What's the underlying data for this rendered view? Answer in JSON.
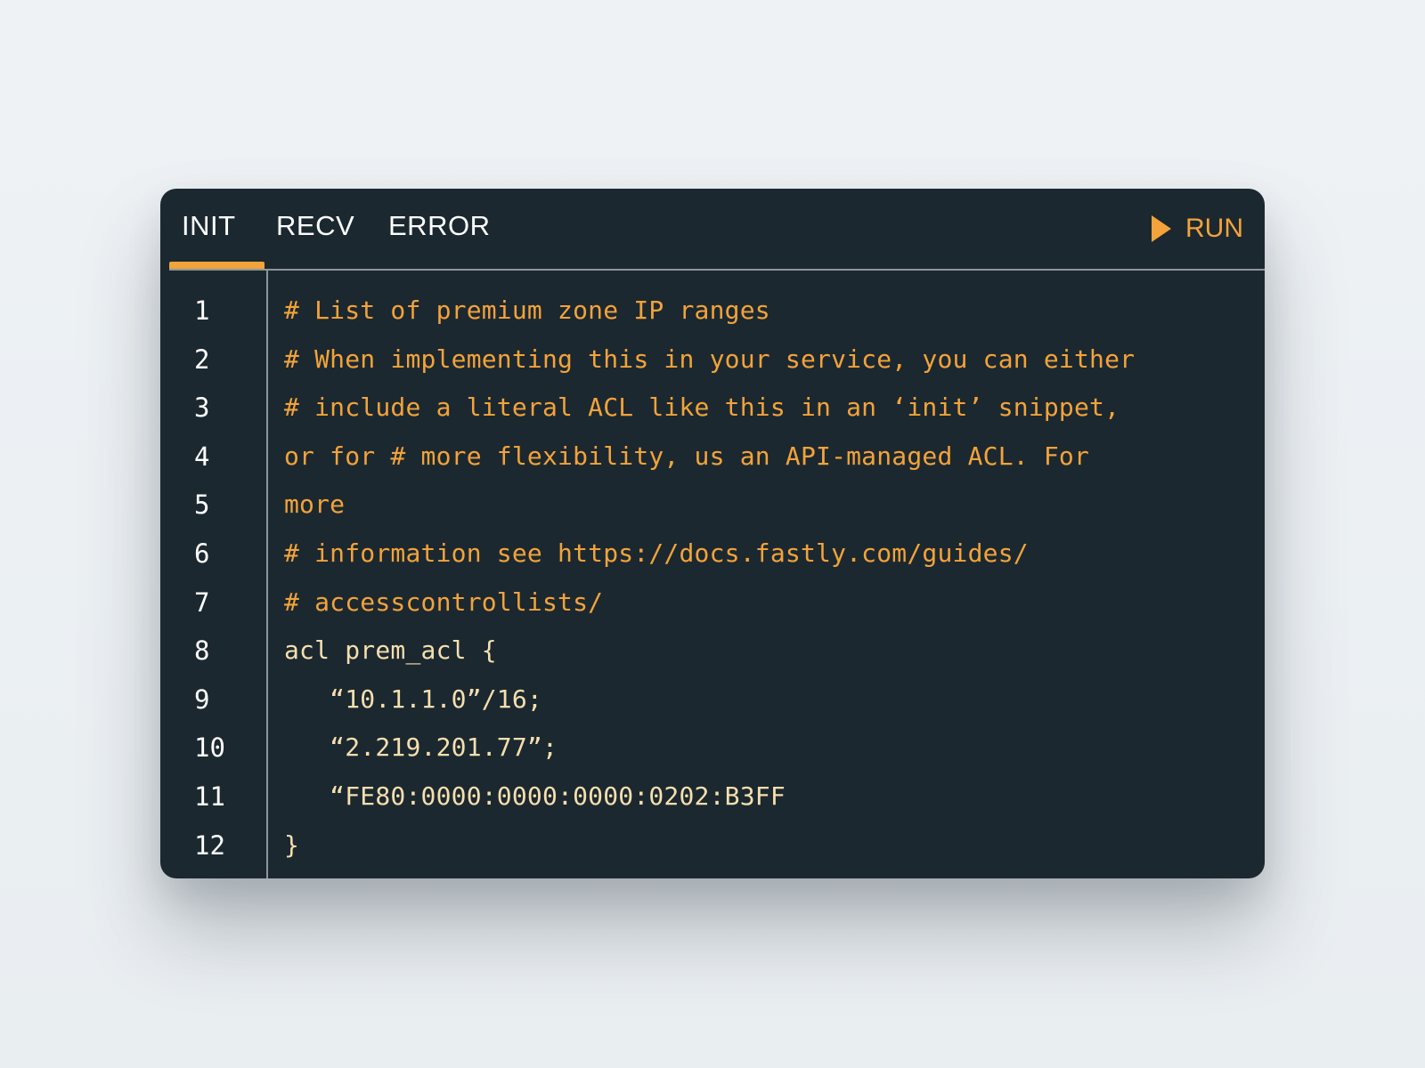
{
  "tabs": [
    {
      "label": "INIT",
      "active": true
    },
    {
      "label": "RECV",
      "active": false
    },
    {
      "label": "ERROR",
      "active": false
    }
  ],
  "run": {
    "label": "RUN",
    "icon": "play-icon"
  },
  "colors": {
    "background": "#eef2f5",
    "editor_bg": "#1c2830",
    "accent": "#f2a33a",
    "code_text": "#f5dfae",
    "divider": "#8d959b"
  },
  "line_numbers": [
    "1",
    "2",
    "3",
    "4",
    "5",
    "6",
    "7",
    "8",
    "9",
    "10",
    "11",
    "12"
  ],
  "code_lines": [
    {
      "text": "# List of premium zone IP ranges",
      "kind": "comment"
    },
    {
      "text": "# When implementing this in your service, you can either",
      "kind": "comment"
    },
    {
      "text": "# include a literal ACL like this in an ‘init’ snippet,",
      "kind": "comment"
    },
    {
      "text": "or for # more flexibility, us an API-managed ACL. For",
      "kind": "comment"
    },
    {
      "text": "more",
      "kind": "comment"
    },
    {
      "text": "# information see https://docs.fastly.com/guides/",
      "kind": "comment"
    },
    {
      "text": "# accesscontrollists/",
      "kind": "comment"
    },
    {
      "text": "acl prem_acl {",
      "kind": "source"
    },
    {
      "text": "   “10.1.1.0”/16;",
      "kind": "source"
    },
    {
      "text": "   “2.219.201.77”;",
      "kind": "source"
    },
    {
      "text": "   “FE80:0000:0000:0000:0202:B3FF",
      "kind": "source"
    },
    {
      "text": "}",
      "kind": "source"
    }
  ]
}
